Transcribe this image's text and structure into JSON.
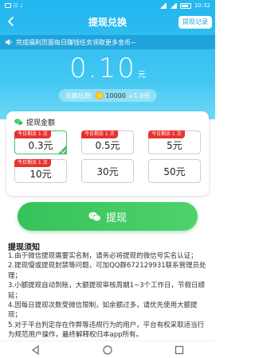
{
  "status_bar": {
    "time": "10:32",
    "left_text": "⊡ ♩"
  },
  "header": {
    "title": "提现兑换",
    "record_label": "提现记录"
  },
  "notice": {
    "text": "完成福利页面每日赚钱任务领取更多金币~"
  },
  "balance": {
    "amount": "0.10",
    "unit": "元"
  },
  "ratio": {
    "label": "兑换比例:",
    "coins": "10000",
    "equals": "=1.0元"
  },
  "withdraw_amount": {
    "title": "提现金额",
    "options": [
      {
        "badge": "今日剩余 1 次",
        "value": "0.3元",
        "selected": true
      },
      {
        "badge": "今日剩余 1 次",
        "value": "0.5元",
        "selected": false
      },
      {
        "badge": "今日剩余 1 次",
        "value": "5元",
        "selected": false
      },
      {
        "badge": "今日剩余 1 次",
        "value": "10元",
        "selected": false
      },
      {
        "badge": "",
        "value": "30元",
        "selected": false
      },
      {
        "badge": "",
        "value": "50元",
        "selected": false
      }
    ]
  },
  "withdraw_button": {
    "label": "提现"
  },
  "rules": {
    "title": "提现须知",
    "items": [
      "1.由于微信提现需要实名制，请务必将提现的微信号实名认证；",
      "2.提现慢或提现封禁等问题，可加QQ群672129931联系管理员处理；",
      "3.小额提现自动到账，大额提现审核周期1~3个工作日，节假日顺延；",
      "4.因每日提现次数受微信限制，如余额过多，请优先使用大额提现；",
      "5.对于平台判定存在作弊等违规行为的用户，平台有权采取适当行为规范用户操作，最终解释权归本app所有。"
    ]
  },
  "colors": {
    "primary": "#25b7f0",
    "green": "#36c25b",
    "badge_red": "#e8322e"
  }
}
